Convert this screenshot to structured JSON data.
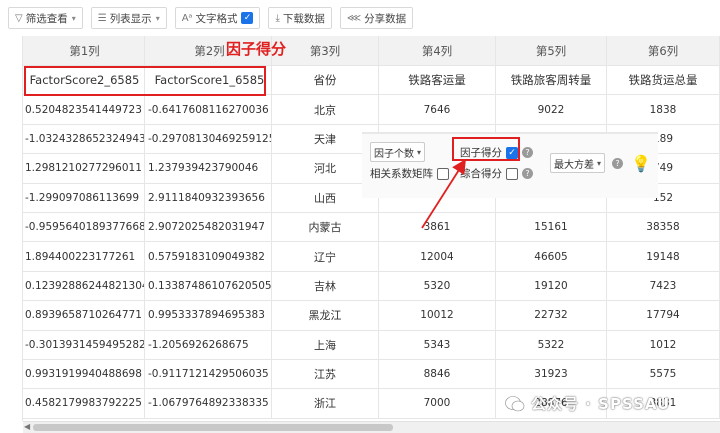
{
  "toolbar": {
    "filter_label": "筛选查看",
    "list_label": "列表显示",
    "textfmt_label": "文字格式",
    "textfmt_checked": true,
    "download_label": "下载数据",
    "share_label": "分享数据"
  },
  "annotation": {
    "label": "因子得分"
  },
  "table": {
    "headers": [
      "第1列",
      "第2列",
      "第3列",
      "第4列",
      "第5列",
      "第6列"
    ],
    "rows": [
      [
        "FactorScore2_6585",
        "FactorScore1_6585",
        "省份",
        "铁路客运量",
        "铁路旅客周转量",
        "铁路货运总量"
      ],
      [
        "0.5204823541449723",
        "-0.6417608116270036",
        "北京",
        "7646",
        "9022",
        "1838"
      ],
      [
        "-1.0324328652324943",
        "-0.29708130469259125",
        "天津",
        "",
        "",
        "189"
      ],
      [
        "1.2981210277296011",
        "1.237939423790046",
        "河北",
        "",
        "",
        "749"
      ],
      [
        "-1.299097086113699",
        "2.9111840932393656",
        "山西",
        "",
        "",
        "152"
      ],
      [
        "-0.9595640189377668",
        "2.9072025482031947",
        "内蒙古",
        "3861",
        "15161",
        "38358"
      ],
      [
        "1.894400223177261",
        "0.5759183109049382",
        "辽宁",
        "12004",
        "46605",
        "19148"
      ],
      [
        "0.12392886244821304",
        "0.13387486107620505",
        "吉林",
        "5320",
        "19120",
        "7423"
      ],
      [
        "0.8939658710264771",
        "0.9953337894695383",
        "黑龙江",
        "10012",
        "22732",
        "17794"
      ],
      [
        "-0.30139314594952826",
        "-1.2056926268675",
        "上海",
        "5343",
        "5322",
        "1012"
      ],
      [
        "0.9931919940488698",
        "-0.9117121429506035",
        "江苏",
        "8846",
        "31923",
        "5575"
      ],
      [
        "0.4582179983792225",
        "-1.0679764892338335",
        "浙江",
        "7000",
        "28876",
        "3831"
      ]
    ]
  },
  "panel": {
    "factor_count_label": "因子个数",
    "factor_score_label": "因子得分",
    "factor_score_checked": true,
    "corr_matrix_label": "相关系数矩阵",
    "corr_matrix_checked": false,
    "composite_label": "综合得分",
    "composite_checked": false,
    "rotation_label": "最大方差"
  },
  "watermark": {
    "text": "公众号 · SPSSAU"
  },
  "colors": {
    "accent": "#1a73e8",
    "highlight": "#e02020",
    "header_bg": "#f2f2f2"
  }
}
